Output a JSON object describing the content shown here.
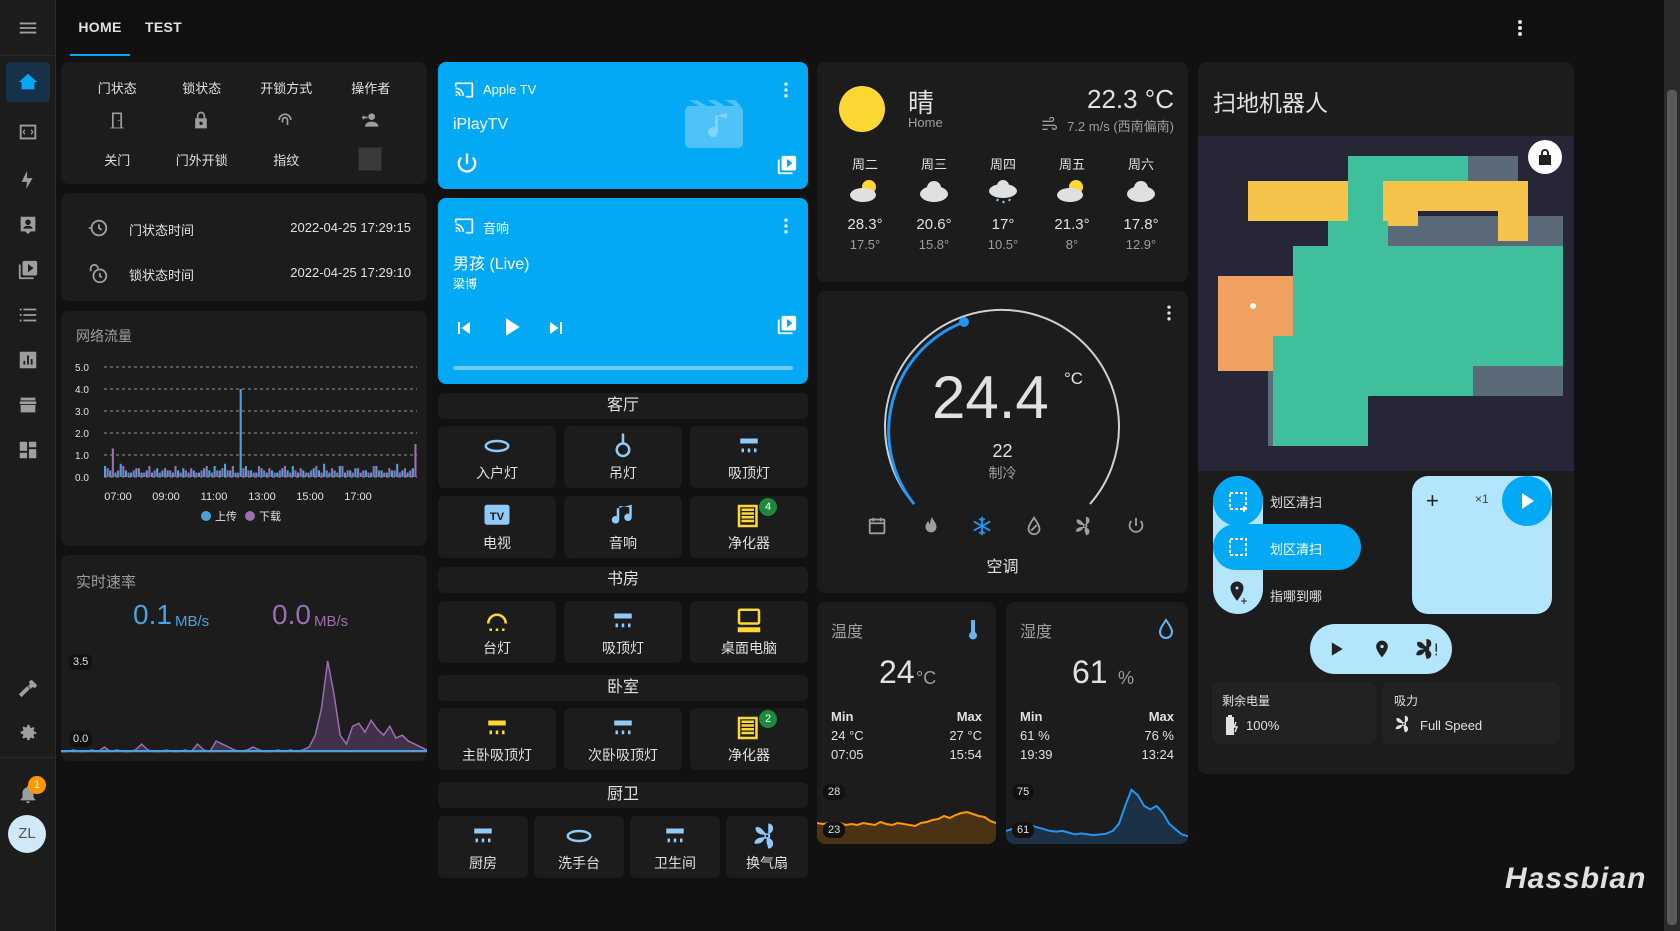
{
  "tabs": [
    "HOME",
    "TEST"
  ],
  "user": {
    "initials": "ZL",
    "notifications": "1"
  },
  "colors": {
    "accent": "#03a9f4",
    "card": "#1c1c1c",
    "bg": "#111111",
    "upload": "#4aa3df",
    "download": "#9a6fb0",
    "yellow": "#fdd835"
  },
  "door": {
    "headers": [
      "门状态",
      "锁状态",
      "开锁方式",
      "操作者"
    ],
    "values": [
      "关门",
      "门外开锁",
      "指纹",
      ""
    ]
  },
  "times": [
    {
      "label": "门状态时间",
      "value": "2022-04-25 17:29:15"
    },
    {
      "label": "锁状态时间",
      "value": "2022-04-25 17:29:10"
    }
  ],
  "network": {
    "title": "网络流量",
    "legend": [
      "上传",
      "下载"
    ]
  },
  "chart_data": {
    "type": "bar",
    "categories": [
      "07:00",
      "",
      "09:00",
      "",
      "11:00",
      "",
      "13:00",
      "",
      "15:00",
      "",
      "17:00",
      ""
    ],
    "xticks": [
      "07:00",
      "09:00",
      "11:00",
      "13:00",
      "15:00",
      "17:00"
    ],
    "yticks": [
      "5.0",
      "4.0",
      "3.0",
      "2.0",
      "1.0",
      "0.0"
    ],
    "ylim": [
      0,
      5
    ],
    "series": [
      {
        "name": "上传",
        "values": [
          0.5,
          0.3,
          0.2,
          0.6,
          0.3,
          0.2,
          0.4,
          0.2,
          0.3,
          0.2,
          0.4,
          0.3,
          0.3,
          0.2,
          0.3,
          0.4,
          0.2,
          0.3,
          0.2,
          0.4,
          0.3,
          0.5,
          0.3,
          0.6,
          0.3,
          0.2,
          4.0,
          0.5,
          0.3,
          0.2,
          0.4,
          0.2,
          0.3,
          0.2,
          0.4,
          0.3,
          0.5,
          0.2,
          0.3,
          0.2,
          0.4,
          0.3,
          0.6,
          0.2,
          0.3,
          0.5,
          0.2,
          0.3,
          0.4,
          0.2,
          0.3,
          0.2,
          0.5,
          0.3,
          0.2,
          0.3,
          0.6,
          0.3,
          0.2,
          0.4
        ]
      },
      {
        "name": "下载",
        "values": [
          0.4,
          1.3,
          0.3,
          0.5,
          0.2,
          0.3,
          0.4,
          0.2,
          0.5,
          0.3,
          0.2,
          0.4,
          0.3,
          0.5,
          0.2,
          0.3,
          0.4,
          0.2,
          0.3,
          0.5,
          0.2,
          0.3,
          0.4,
          0.3,
          0.5,
          0.2,
          0.4,
          0.3,
          0.2,
          0.5,
          0.3,
          0.4,
          0.2,
          0.3,
          0.5,
          0.2,
          0.3,
          0.4,
          0.2,
          0.3,
          0.5,
          0.2,
          0.3,
          0.4,
          0.2,
          0.5,
          0.3,
          0.2,
          0.4,
          0.3,
          0.2,
          0.5,
          0.3,
          0.2,
          0.4,
          0.3,
          0.2,
          0.4,
          0.3,
          1.5
        ]
      }
    ]
  },
  "speed": {
    "title": "实时速率",
    "up": "0.1",
    "down": "0.0",
    "unit": "MB/s",
    "ymax": "3.5",
    "ymin": "0.0",
    "series": [
      0.05,
      0.05,
      0.1,
      0.05,
      0.05,
      0.1,
      0.05,
      0.2,
      0.05,
      0.1,
      0.05,
      0.05,
      0.1,
      0.3,
      0.1,
      0.05,
      0.05,
      0.1,
      0.05,
      0.05,
      0.1,
      0.05,
      0.3,
      0.1,
      0.05,
      0.4,
      0.3,
      0.2,
      0.1,
      0.05,
      0.1,
      0.2,
      0.1,
      0.05,
      0.05,
      0.1,
      0.05,
      0.1,
      0.05,
      0.1,
      0.2,
      0.6,
      1.5,
      3.1,
      2.0,
      0.6,
      0.3,
      0.9,
      1.0,
      0.7,
      1.1,
      0.8,
      0.6,
      0.9,
      0.5,
      0.6,
      0.4,
      0.3,
      0.2,
      0.1
    ]
  },
  "appletv": {
    "name": "Apple TV",
    "title": "iPlayTV"
  },
  "speaker": {
    "name": "音响",
    "title": "男孩 (Live)",
    "artist": "梁博"
  },
  "rooms": {
    "r1": {
      "title": "客厅",
      "items": [
        "入户灯",
        "吊灯",
        "吸顶灯",
        "电视",
        "音响",
        "净化器"
      ],
      "badge": "4"
    },
    "r2": {
      "title": "书房",
      "items": [
        "台灯",
        "吸顶灯",
        "桌面电脑"
      ]
    },
    "r3": {
      "title": "卧室",
      "items": [
        "主卧吸顶灯",
        "次卧吸顶灯",
        "净化器"
      ],
      "badge": "2"
    },
    "r4": {
      "title": "厨卫",
      "items": [
        "厨房",
        "洗手台",
        "卫生间",
        "换气扇"
      ]
    }
  },
  "weather": {
    "condition": "晴",
    "location": "Home",
    "temp": "22.3 °C",
    "wind": "7.2 m/s (西南偏南)",
    "days": [
      {
        "day": "周二",
        "high": "28.3°",
        "low": "17.5°"
      },
      {
        "day": "周三",
        "high": "20.6°",
        "low": "15.8°"
      },
      {
        "day": "周四",
        "high": "17°",
        "low": "10.5°"
      },
      {
        "day": "周五",
        "high": "21.3°",
        "low": "8°"
      },
      {
        "day": "周六",
        "high": "17.8°",
        "low": "12.9°"
      }
    ]
  },
  "ac": {
    "current": "24.4",
    "unit": "°C",
    "target": "22",
    "mode": "制冷",
    "name": "空调"
  },
  "temperature": {
    "title": "温度",
    "value": "24",
    "unit": "°C",
    "min_label": "Min",
    "max_label": "Max",
    "min": "24 °C",
    "max": "27 °C",
    "min_time": "07:05",
    "max_time": "15:54",
    "ytop": "28",
    "ybot": "23",
    "series": [
      24.5,
      24.4,
      24.5,
      24.4,
      24.5,
      24.3,
      24.4,
      24.3,
      24.5,
      24.4,
      24.3,
      24.6,
      24.4,
      24.3,
      24.5,
      24.4,
      24.3,
      24.2,
      24.5,
      24.6,
      24.8,
      24.9,
      25.2,
      25.0,
      25.3,
      25.5,
      25.6,
      25.4,
      25.2,
      25.1,
      24.7,
      24.5
    ]
  },
  "humidity": {
    "title": "湿度",
    "value": "61",
    "unit": "%",
    "min_label": "Min",
    "max_label": "Max",
    "min": "61 %",
    "max": "76 %",
    "min_time": "19:39",
    "max_time": "13:24",
    "ytop": "75",
    "ybot": "61",
    "series": [
      63,
      63.5,
      64,
      63.8,
      64.5,
      64,
      63.5,
      63,
      62.8,
      63,
      62.5,
      62,
      62.3,
      62,
      61.8,
      62,
      62.2,
      63,
      65,
      70,
      74.5,
      73,
      70,
      69,
      70,
      68,
      65,
      63.5,
      62,
      61.5
    ]
  },
  "robot": {
    "title": "扫地机器人",
    "buttons": [
      "划区清扫",
      "划区清扫",
      "指哪到哪"
    ],
    "count": "×1",
    "battery_label": "剩余电量",
    "battery": "100%",
    "fan_label": "吸力",
    "fan": "Full Speed"
  },
  "watermark": "Hassbian"
}
